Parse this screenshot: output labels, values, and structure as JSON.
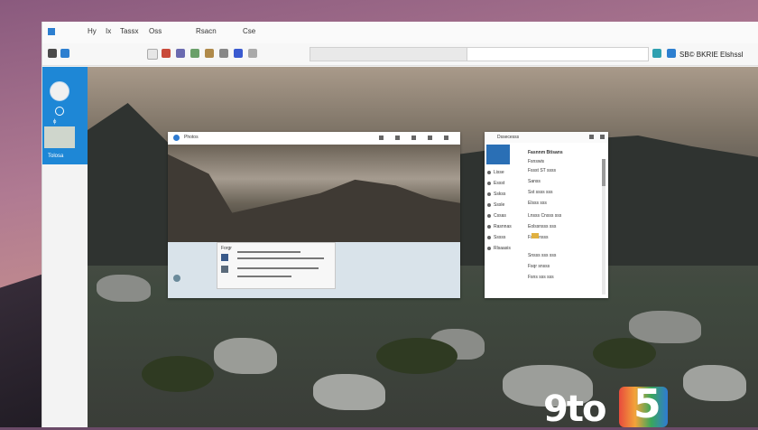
{
  "menubar": {
    "items": [
      "Hy",
      "Ix",
      "Tassx",
      "Oss",
      "Rsacn",
      "Cse"
    ]
  },
  "toolbar": {
    "address_right_text": "SB© BKRIE Elshssl"
  },
  "sidebar": {
    "small_label": "ϕ",
    "thumb_label": "Tolosa"
  },
  "photo_window": {
    "title": "Photos",
    "card_title": "Forgr",
    "card_line1": "Fs▒▒▒▒▒▒▒▒▒▒▒▒▒▒▒▒▒",
    "card_line2": "▒▒▒▒▒▒▒▒▒▒▒▒▒▒▒▒▒▒"
  },
  "settings_window": {
    "title": "Dssecesss",
    "heading": "Fasnnm Btisans",
    "nav": [
      "Lisse",
      "Essst",
      "Sskss",
      "Sssle",
      "Cssas",
      "Rasnnas",
      "Sssss",
      "Rlsaasis"
    ],
    "lines": [
      "Fsnswis",
      "Fssst ST ssss",
      "Sanss",
      "Sst ssss sss",
      "Elsss sss",
      "Lnsss Cnsss sss",
      "Eolssnsss sss",
      "Fsse nsss",
      "Snsss sss sss",
      "Fsqr snsss",
      "Fsns sss sss"
    ]
  },
  "watermark": {
    "text": "9to",
    "brand": "5"
  },
  "colors": {
    "accent": "#1e87d6",
    "window_bg": "#f3f3f3"
  }
}
